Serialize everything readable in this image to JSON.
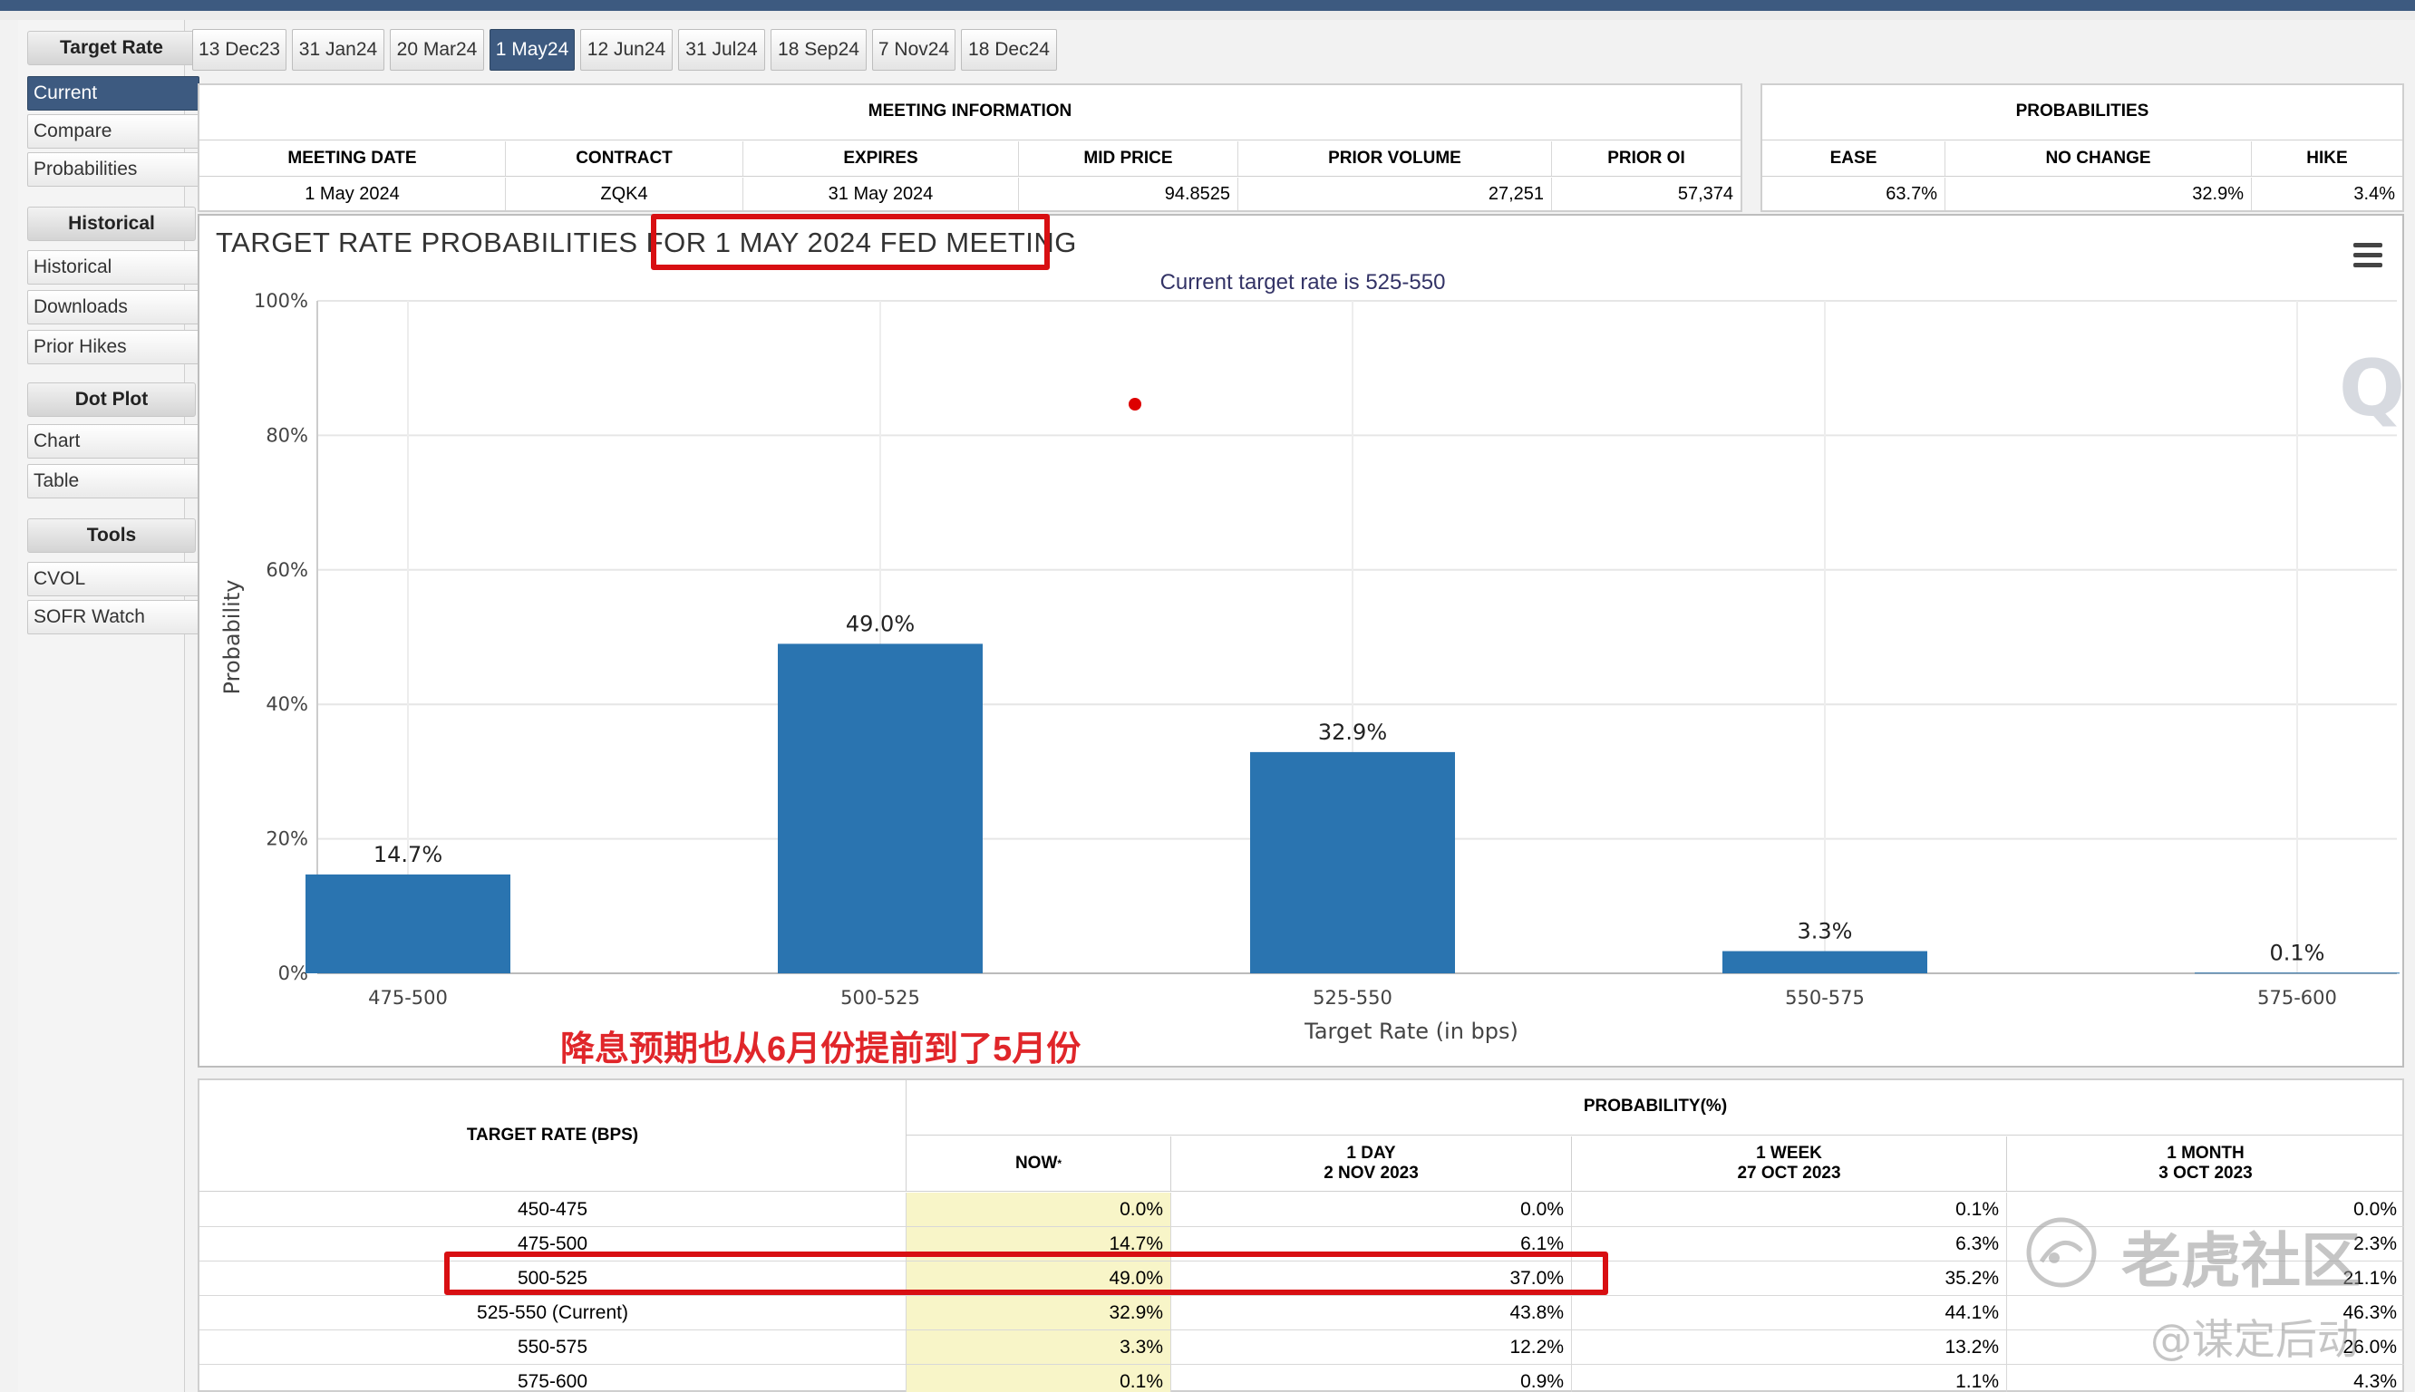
{
  "sidebar": {
    "sections": [
      {
        "label": "Target Rate",
        "items": [
          "Current",
          "Compare",
          "Probabilities"
        ]
      },
      {
        "label": "Historical",
        "items": [
          "Historical",
          "Downloads",
          "Prior Hikes"
        ]
      },
      {
        "label": "Dot Plot",
        "items": [
          "Chart",
          "Table"
        ]
      },
      {
        "label": "Tools",
        "items": [
          "CVOL",
          "SOFR Watch"
        ]
      }
    ],
    "active_item": "Current"
  },
  "tabs": [
    "13 Dec23",
    "31 Jan24",
    "20 Mar24",
    "1 May24",
    "12 Jun24",
    "31 Jul24",
    "18 Sep24",
    "7 Nov24",
    "18 Dec24"
  ],
  "active_tab": "1 May24",
  "meeting_info": {
    "title": "MEETING INFORMATION",
    "headers": [
      "MEETING DATE",
      "CONTRACT",
      "EXPIRES",
      "MID PRICE",
      "PRIOR VOLUME",
      "PRIOR OI"
    ],
    "values": [
      "1 May 2024",
      "ZQK4",
      "31 May 2024",
      "94.8525",
      "27,251",
      "57,374"
    ]
  },
  "probabilities": {
    "title": "PROBABILITIES",
    "headers": [
      "EASE",
      "NO CHANGE",
      "HIKE"
    ],
    "values": [
      "63.7%",
      "32.9%",
      "3.4%"
    ]
  },
  "chart": {
    "title_prefix": "TARGET RATE PROBABILITIES FOR",
    "title_highlight": "1 MAY 2024 FED MEETING",
    "subtitle": "Current target rate is 525-550",
    "watermark_logo": "Q"
  },
  "chart_data": {
    "type": "bar",
    "categories": [
      "475-500",
      "500-525",
      "525-550",
      "550-575",
      "575-600"
    ],
    "values": [
      14.7,
      49.0,
      32.9,
      3.3,
      0.1
    ],
    "value_labels": [
      "14.7%",
      "49.0%",
      "32.9%",
      "3.3%",
      "0.1%"
    ],
    "title": "TARGET RATE PROBABILITIES FOR 1 MAY 2024 FED MEETING",
    "subtitle": "Current target rate is 525-550",
    "xlabel": "Target Rate (in bps)",
    "ylabel": "Probability",
    "ylim": [
      0,
      100
    ],
    "yticks": [
      "0%",
      "20%",
      "40%",
      "60%",
      "80%",
      "100%"
    ],
    "grid": true,
    "bar_color": "#2a74b0"
  },
  "annotation": "降息预期也从6月份提前到了5月份",
  "prob_table": {
    "rate_header": "TARGET RATE (BPS)",
    "group_header": "PROBABILITY(%)",
    "columns": [
      {
        "line1": "NOW",
        "line2": "",
        "sup": "*"
      },
      {
        "line1": "1 DAY",
        "line2": "2 NOV 2023"
      },
      {
        "line1": "1 WEEK",
        "line2": "27 OCT 2023"
      },
      {
        "line1": "1 MONTH",
        "line2": "3 OCT 2023"
      }
    ],
    "rows": [
      {
        "rate": "450-475",
        "now": "0.0%",
        "day": "0.0%",
        "week": "0.1%",
        "month": "0.0%"
      },
      {
        "rate": "475-500",
        "now": "14.7%",
        "day": "6.1%",
        "week": "6.3%",
        "month": "2.3%"
      },
      {
        "rate": "500-525",
        "now": "49.0%",
        "day": "37.0%",
        "week": "35.2%",
        "month": "21.1%"
      },
      {
        "rate": "525-550 (Current)",
        "now": "32.9%",
        "day": "43.8%",
        "week": "44.1%",
        "month": "46.3%"
      },
      {
        "rate": "550-575",
        "now": "3.3%",
        "day": "12.2%",
        "week": "13.2%",
        "month": "26.0%"
      },
      {
        "rate": "575-600",
        "now": "0.1%",
        "day": "0.9%",
        "week": "1.1%",
        "month": "4.3%"
      }
    ]
  },
  "watermarks": {
    "brand": "老虎社区",
    "user": "@谋定后动"
  },
  "colors": {
    "accent": "#3d5a80",
    "bar": "#2a74b0",
    "highlight": "#d80f12",
    "now_column": "#f8f5c8"
  }
}
